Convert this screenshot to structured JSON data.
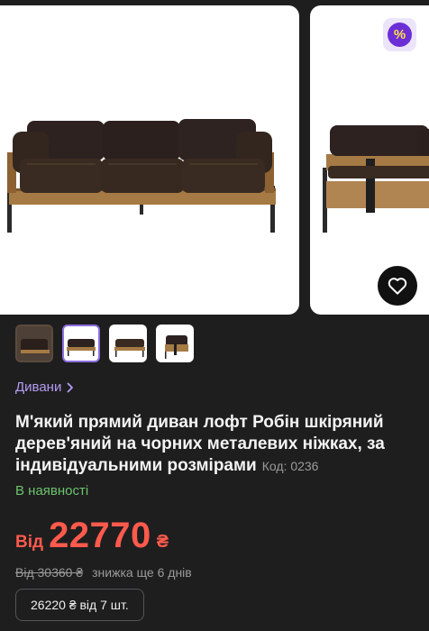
{
  "gallery": {
    "badge_symbol": "%",
    "accent": "#6c2fd6",
    "badge_symbol_color": "#ffe14a"
  },
  "thumbnails": [
    {
      "label": "photo-1"
    },
    {
      "label": "photo-2"
    },
    {
      "label": "photo-3"
    },
    {
      "label": "photo-4"
    }
  ],
  "breadcrumb": {
    "label": "Дивани"
  },
  "product": {
    "title": "М'який прямий диван лофт Робін шкіряний дерев'яний на чорних металевих ніжках, за індивідуальними розмірами",
    "code": "Код: 0236",
    "availability": "В наявності",
    "price_prefix": "Від",
    "price": "22770",
    "currency": "₴",
    "old_price": "Від 30360 ₴",
    "discount_note": "знижка ще 6 днів",
    "bulk_price": "26220 ₴ від 7 шт."
  },
  "colors": {
    "price": "#ff5a4c",
    "availability": "#6cc36c",
    "link": "#b39cf2"
  }
}
